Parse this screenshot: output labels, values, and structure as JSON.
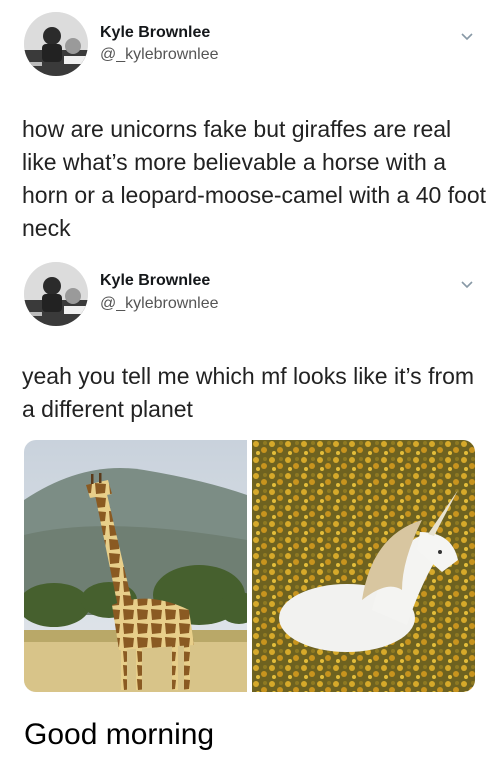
{
  "tweets": [
    {
      "author": "Kyle Brownlee",
      "handle": "@_kylebrownlee",
      "text": "how are unicorns fake but giraffes are real like what’s more believable a horse with a horn or a leopard-moose-camel with a 40 foot neck"
    },
    {
      "author": "Kyle Brownlee",
      "handle": "@_kylebrownlee",
      "text": "yeah you tell me which mf looks like it’s from a different planet"
    }
  ],
  "caption": "Good morning",
  "icons": {
    "menu": "chevron-down-icon",
    "avatar": "profile-photo"
  },
  "colors": {
    "text": "#14171a",
    "handle": "#555555",
    "background": "#ffffff"
  }
}
